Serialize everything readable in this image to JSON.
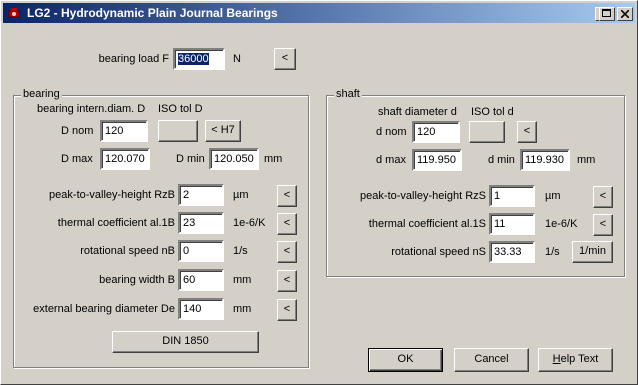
{
  "window": {
    "title": "LG2 - Hydrodynamic Plain Journal Bearings",
    "icon": "app-icon"
  },
  "titlebar_buttons": [
    "minimize-button",
    "maximize-button",
    "close-button"
  ],
  "load": {
    "label": "bearing load F",
    "value": "36000",
    "unit": "N",
    "button": "<"
  },
  "bearing": {
    "group_title": "bearing",
    "diam_label": "bearing intern.diam. D",
    "iso_label": "ISO tol D",
    "dnom_label": "D nom",
    "dnom_value": "120",
    "iso_value": "",
    "iso_button": "< H7",
    "dmax_label": "D max",
    "dmax_value": "120.070",
    "dmin_label": "D min",
    "dmin_value": "120.050",
    "dmm_unit": "mm",
    "rows": [
      {
        "label": "peak-to-valley-height RzB",
        "value": "2",
        "unit": "µm",
        "button": "<"
      },
      {
        "label": "thermal coefficient al.1B",
        "value": "23",
        "unit": "1e-6/K",
        "button": "<"
      },
      {
        "label": "rotational speed nB",
        "value": "0",
        "unit": "1/s",
        "button": "<"
      },
      {
        "label": "bearing width B",
        "value": "60",
        "unit": "mm",
        "button": "<"
      },
      {
        "label": "external bearing diameter De",
        "value": "140",
        "unit": "mm",
        "button": "<"
      }
    ],
    "din_button": "DIN 1850"
  },
  "shaft": {
    "group_title": "shaft",
    "diam_label": "shaft diameter d",
    "iso_label": "ISO tol d",
    "dnom_label": "d nom",
    "dnom_value": "120",
    "iso_value": "",
    "iso_button": "<",
    "dmax_label": "d max",
    "dmax_value": "119.950",
    "dmin_label": "d min",
    "dmin_value": "119.930",
    "dmm_unit": "mm",
    "rows": [
      {
        "label": "peak-to-valley-height RzS",
        "value": "1",
        "unit": "µm",
        "button": "<"
      },
      {
        "label": "thermal coefficient al.1S",
        "value": "11",
        "unit": "1e-6/K",
        "button": "<"
      },
      {
        "label": "rotational speed nS",
        "value": "33.33",
        "unit": "1/s",
        "button": "1/min"
      }
    ]
  },
  "footer": {
    "ok": "OK",
    "cancel": "Cancel",
    "help_h": "H",
    "help_rest": "elp Text"
  }
}
